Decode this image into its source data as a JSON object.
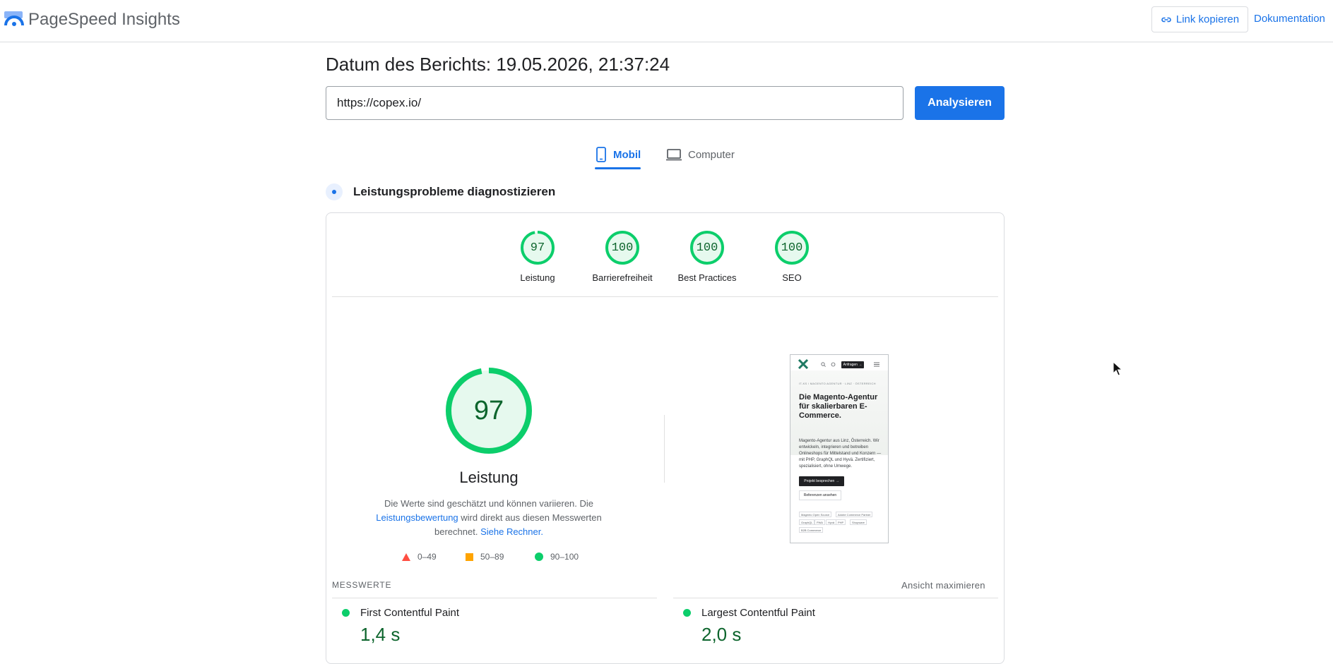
{
  "header": {
    "brand": "PageSpeed Insights",
    "copy_link_label": "Link kopieren",
    "docs_label": "Dokumentation"
  },
  "report": {
    "date_text": "Datum des Berichts: 19.05.2026, 21:37:24",
    "url_value": "https://copex.io/",
    "analyze_label": "Analysieren"
  },
  "tabs": [
    {
      "label": "Mobil",
      "icon": "smartphone-icon",
      "selected": true
    },
    {
      "label": "Computer",
      "icon": "laptop-icon",
      "selected": false
    }
  ],
  "diagnose_title": "Leistungsprobleme diagnostizieren",
  "categories": [
    {
      "label": "Leistung",
      "score": 97
    },
    {
      "label": "Barrierefreiheit",
      "score": 100
    },
    {
      "label": "Best Practices",
      "score": 100
    },
    {
      "label": "SEO",
      "score": 100
    }
  ],
  "performance": {
    "score": 97,
    "title": "Leistung",
    "desc_1": "Die Werte sind geschätzt und können variieren. Die",
    "desc_link_1": "Leistungsbewertung",
    "desc_2": "wird direkt aus diesen Messwerten berechnet.",
    "desc_link_2": "Siehe Rechner."
  },
  "legend": [
    {
      "range": "0–49",
      "color": "#ff4e42",
      "shape": "triangle"
    },
    {
      "range": "50–89",
      "color": "#ffa400",
      "shape": "square"
    },
    {
      "range": "90–100",
      "color": "#0cce6b",
      "shape": "circle"
    }
  ],
  "screenshot": {
    "anfragen": "Anfragen →",
    "crumb": "IT-KS / MAGENTO AGENTUR · LINZ · ÖSTERREICH",
    "title": "Die Magento-Agentur für skalierbaren E-Commerce.",
    "text": "Magento-Agentur aus Linz, Österreich. Wir entwickeln, integrieren und betreiben Onlineshops für Mittelstand und Konzern — mit PHP, GraphQL und Hyvä. Zertifiziert, spezialisiert, ohne Umwege.",
    "btn_primary": "Projekt besprechen →",
    "btn_secondary": "Referenzen ansehen",
    "tags": [
      "Magento Open Source",
      "Adobe Commerce Partner",
      "GraphQL",
      "PWA",
      "Hyvä",
      "PHP",
      "Shopware",
      "B2B Commerce"
    ]
  },
  "metrics": {
    "section_label": "MESSWERTE",
    "expand_label": "Ansicht maximieren",
    "items": [
      {
        "name": "First Contentful Paint",
        "value": "1,4 s"
      },
      {
        "name": "Largest Contentful Paint",
        "value": "2,0 s"
      }
    ]
  },
  "colors": {
    "accent": "#1a73e8",
    "pass": "#0cce6b",
    "pass_text": "#0d652d",
    "pass_fill": "#e6f9ee"
  }
}
